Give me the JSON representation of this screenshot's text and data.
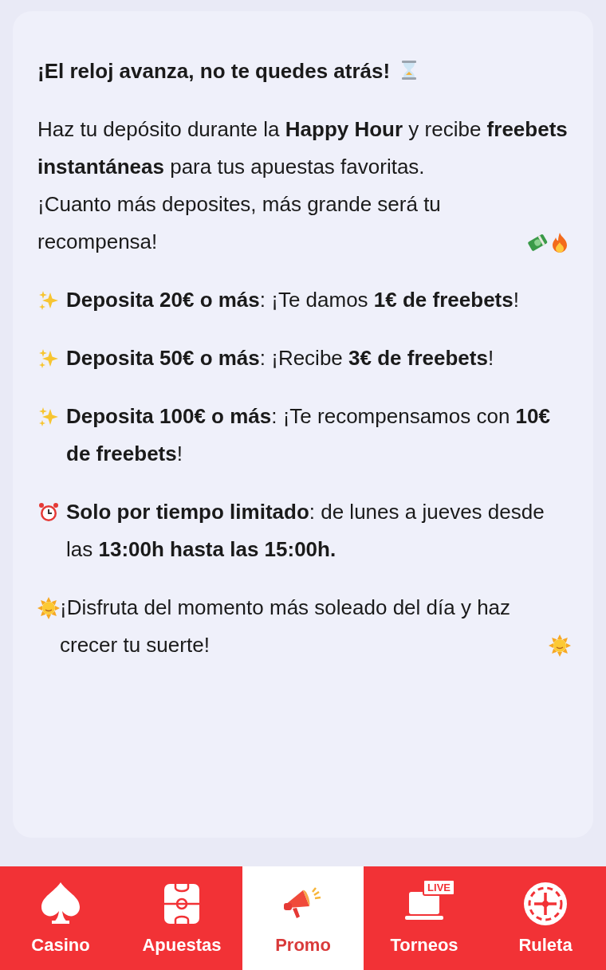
{
  "content": {
    "paragraphs": [
      {
        "kind": "heading",
        "lines": [
          "¡El reloj avanza, no te quedes atrás!"
        ]
      },
      {
        "kind": "intro",
        "lines": [
          "Haz tu depósito durante la **Happy Hour** y recibe **freebets instantáneas** para tus apuestas favoritas.",
          "¡Cuanto más deposites, más grande será tu recompensa!"
        ]
      },
      {
        "kind": "offer",
        "lines": [
          "**Deposita 20€ o más**: ¡Te damos **1€ de freebets**!"
        ]
      },
      {
        "kind": "offer",
        "lines": [
          "**Deposita 50€ o más**: ¡Recibe **3€ de freebets**!"
        ]
      },
      {
        "kind": "offer",
        "lines": [
          "**Deposita 100€ o más**: ¡Te recompensamos con **10€ de freebets**!"
        ]
      },
      {
        "kind": "notice",
        "lines": [
          "**Solo por tiempo limitado**: de lunes a jueves desde las **13:00h hasta las 15:00h.**"
        ]
      },
      {
        "kind": "closing",
        "lines": [
          "¡Disfruta del momento más soleado del día y haz crecer tu suerte!"
        ]
      }
    ]
  },
  "nav": {
    "items": [
      {
        "kind": "casino",
        "label": "Casino",
        "selected": false
      },
      {
        "kind": "bets",
        "label": "Apuestas",
        "selected": false
      },
      {
        "kind": "promo",
        "label": "Promo",
        "selected": true
      },
      {
        "kind": "tournaments",
        "label": "Torneos",
        "selected": false,
        "badge": "LIVE"
      },
      {
        "kind": "roulette",
        "label": "Ruleta",
        "selected": false
      }
    ]
  }
}
